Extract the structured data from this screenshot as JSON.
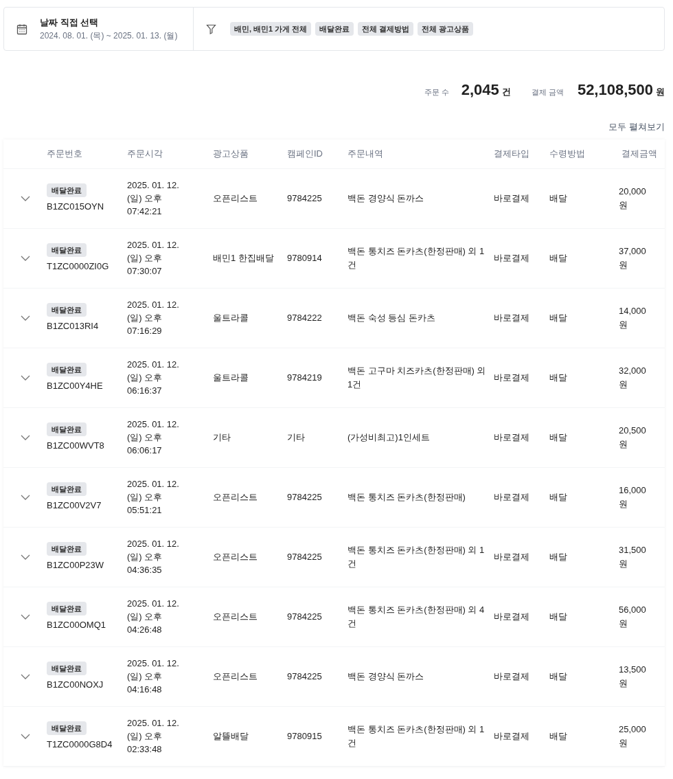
{
  "date_filter": {
    "title": "날짜 직접 선택",
    "range": "2024. 08. 01. (목) ~ 2025. 01. 13. (월)"
  },
  "filter_tags": [
    "배민, 배민1 가게 전체",
    "배달완료",
    "전체 결제방법",
    "전체 광고상품"
  ],
  "summary": {
    "order_count_label": "주문 수",
    "order_count": "2,045",
    "order_count_unit": "건",
    "amount_label": "결제 금액",
    "amount": "52,108,500",
    "amount_unit": "원"
  },
  "expand_all": "모두 펼쳐보기",
  "table": {
    "columns": [
      "주문번호",
      "주문시각",
      "광고상품",
      "캠페인ID",
      "주문내역",
      "결제타입",
      "수령방법",
      "결제금액"
    ],
    "rows": [
      {
        "expanded": false,
        "status": "배달완료",
        "order_no": "B1ZC015OYN",
        "time": "2025. 01. 12. (일) 오후 07:42:21",
        "ad_product": "오픈리스트",
        "campaign_id": "9784225",
        "items": "백돈 경양식 돈까스",
        "pay_type": "바로결제",
        "delivery": "배달",
        "amount": "20,000 원"
      },
      {
        "expanded": false,
        "status": "배달완료",
        "order_no": "T1ZC0000ZI0G",
        "time": "2025. 01. 12. (일) 오후 07:30:07",
        "ad_product": "배민1 한집배달",
        "campaign_id": "9780914",
        "items": "백돈 통치즈 돈카츠(한정판매) 외 1건",
        "pay_type": "바로결제",
        "delivery": "배달",
        "amount": "37,000 원"
      },
      {
        "expanded": false,
        "status": "배달완료",
        "order_no": "B1ZC013RI4",
        "time": "2025. 01. 12. (일) 오후 07:16:29",
        "ad_product": "울트라콜",
        "campaign_id": "9784222",
        "items": "백돈 숙성 등심 돈카츠",
        "pay_type": "바로결제",
        "delivery": "배달",
        "amount": "14,000 원"
      },
      {
        "expanded": false,
        "status": "배달완료",
        "order_no": "B1ZC00Y4HE",
        "time": "2025. 01. 12. (일) 오후 06:16:37",
        "ad_product": "울트라콜",
        "campaign_id": "9784219",
        "items": "백돈 고구마 치즈카츠(한정판매) 외 1건",
        "pay_type": "바로결제",
        "delivery": "배달",
        "amount": "32,000 원"
      },
      {
        "expanded": false,
        "status": "배달완료",
        "order_no": "B1ZC00WVT8",
        "time": "2025. 01. 12. (일) 오후 06:06:17",
        "ad_product": "기타",
        "campaign_id": "기타",
        "items": "(가성비최고)1인세트",
        "pay_type": "바로결제",
        "delivery": "배달",
        "amount": "20,500 원"
      },
      {
        "expanded": false,
        "status": "배달완료",
        "order_no": "B1ZC00V2V7",
        "time": "2025. 01. 12. (일) 오후 05:51:21",
        "ad_product": "오픈리스트",
        "campaign_id": "9784225",
        "items": "백돈 통치즈 돈카츠(한정판매)",
        "pay_type": "바로결제",
        "delivery": "배달",
        "amount": "16,000 원"
      },
      {
        "expanded": false,
        "status": "배달완료",
        "order_no": "B1ZC00P23W",
        "time": "2025. 01. 12. (일) 오후 04:36:35",
        "ad_product": "오픈리스트",
        "campaign_id": "9784225",
        "items": "백돈 통치즈 돈카츠(한정판매) 외 1건",
        "pay_type": "바로결제",
        "delivery": "배달",
        "amount": "31,500 원"
      },
      {
        "expanded": false,
        "status": "배달완료",
        "order_no": "B1ZC00OMQ1",
        "time": "2025. 01. 12. (일) 오후 04:26:48",
        "ad_product": "오픈리스트",
        "campaign_id": "9784225",
        "items": "백돈 통치즈 돈카츠(한정판매) 외 4건",
        "pay_type": "바로결제",
        "delivery": "배달",
        "amount": "56,000 원"
      },
      {
        "expanded": false,
        "status": "배달완료",
        "order_no": "B1ZC00NOXJ",
        "time": "2025. 01. 12. (일) 오후 04:16:48",
        "ad_product": "오픈리스트",
        "campaign_id": "9784225",
        "items": "백돈 경양식 돈까스",
        "pay_type": "바로결제",
        "delivery": "배달",
        "amount": "13,500 원"
      },
      {
        "expanded": false,
        "status": "배달완료",
        "order_no": "T1ZC0000G8D4",
        "time": "2025. 01. 12. (일) 오후 02:33:48",
        "ad_product": "알뜰배달",
        "campaign_id": "9780915",
        "items": "백돈 통치즈 돈카츠(한정판매) 외 1건",
        "pay_type": "바로결제",
        "delivery": "배달",
        "amount": "25,000 원"
      }
    ]
  }
}
